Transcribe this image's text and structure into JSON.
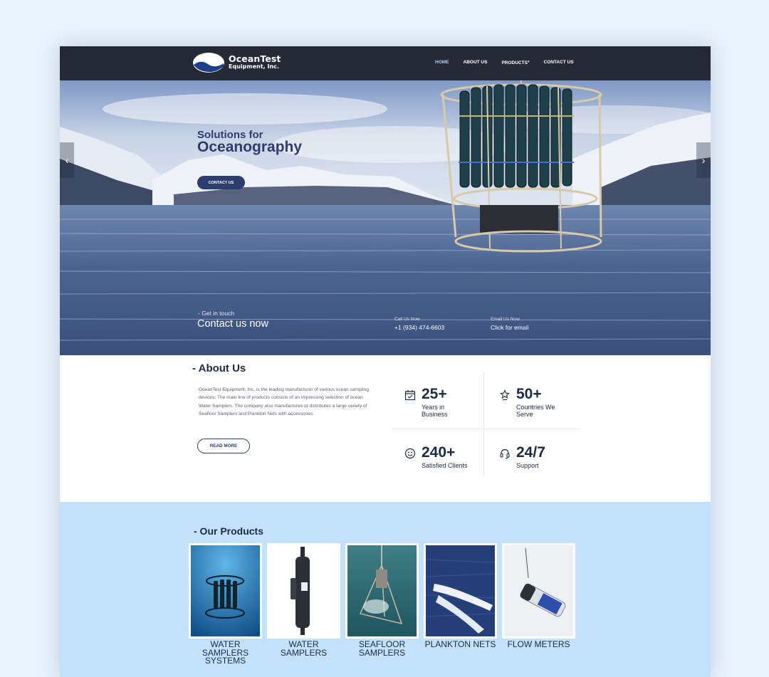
{
  "nav": {
    "logo_title": "OceanTest",
    "logo_subtitle": "Equipment, Inc.",
    "menu": [
      "HOME",
      "ABOUT US",
      "PRODUCTS",
      "CONTACT US"
    ]
  },
  "hero": {
    "kicker": "Solutions for",
    "title": "Oceanography",
    "button": "CONTACT US",
    "get_in_touch": "- Get in touch",
    "contact_now": "Contact us now",
    "call_label": "Call Us Now",
    "call_value": "+1 (934) 474-6603",
    "email_label": "Email Us Now",
    "email_value": "Click for email"
  },
  "about": {
    "heading": "- About Us",
    "body": "OceanTest Equipment, Inc. is the leading manufacturer of various ocean sampling devices. The main line of products consists of an impressing selection of ocean Water Samplers. The company also manufactures or distributes a large variety of Seafloor Samplers and Plankton Nets with accessories.",
    "button": "READ MORE"
  },
  "stats": [
    {
      "value": "25+",
      "label": "Years in Business",
      "icon": "calendar-icon"
    },
    {
      "value": "50+",
      "label": "Countries We Serve",
      "icon": "star-award-icon"
    },
    {
      "value": "240+",
      "label": "Satisfied Clients",
      "icon": "smiley-icon"
    },
    {
      "value": "24/7",
      "label": "Support",
      "icon": "headset-icon"
    }
  ],
  "products": {
    "heading": "- Our Products",
    "items": [
      {
        "name": "WATER SAMPLERS SYSTEMS"
      },
      {
        "name": "WATER SAMPLERS"
      },
      {
        "name": "SEAFLOOR SAMPLERS"
      },
      {
        "name": "PLANKTON NETS"
      },
      {
        "name": "FLOW METERS"
      }
    ]
  },
  "colors": {
    "nav_bg": "#262a37",
    "accent": "#2d3d6e",
    "products_bg": "#c3e1fa",
    "page_bg": "#e9f3fd"
  }
}
